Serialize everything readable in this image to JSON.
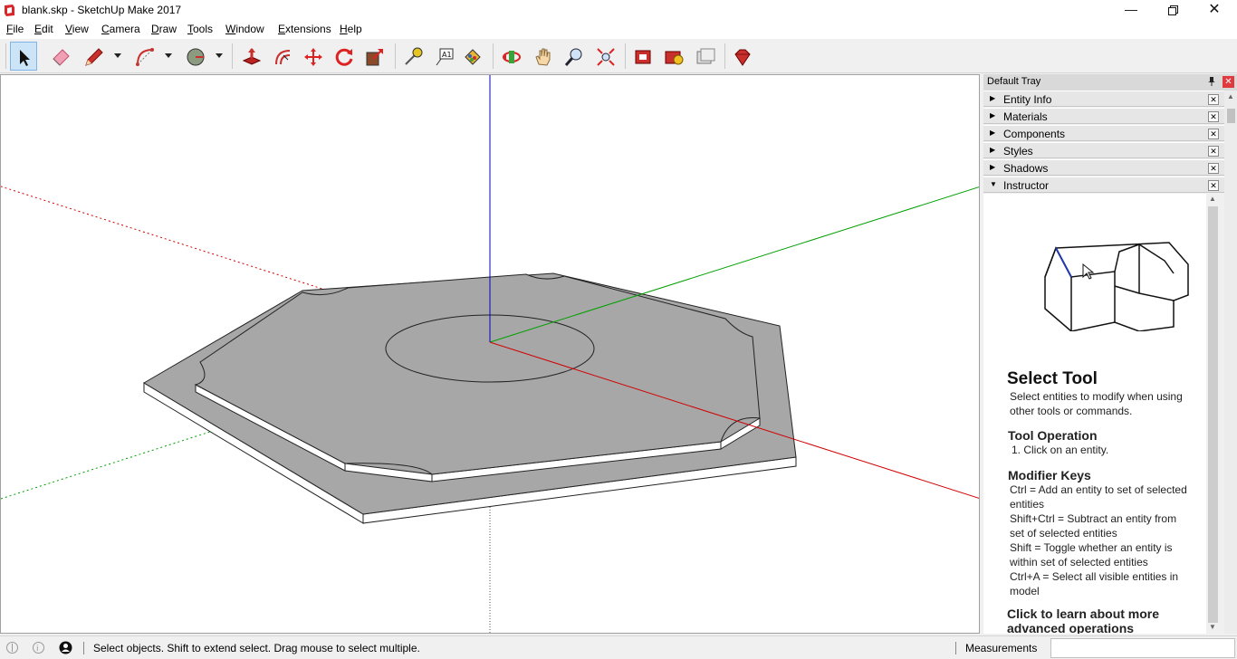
{
  "window": {
    "title": "blank.skp - SketchUp Make 2017"
  },
  "menu": [
    "File",
    "Edit",
    "View",
    "Camera",
    "Draw",
    "Tools",
    "Window",
    "Extensions",
    "Help"
  ],
  "toolbar": {
    "tools": [
      "select",
      "eraser",
      "line",
      "arc",
      "shapes",
      "push-pull",
      "offset",
      "move",
      "rotate",
      "scale",
      "tape-measure",
      "text",
      "paint-bucket",
      "orbit",
      "pan",
      "zoom",
      "zoom-extents",
      "3d-warehouse",
      "extension-warehouse",
      "layout",
      "extension-manager"
    ],
    "active_tool": "select"
  },
  "tray": {
    "title": "Default Tray",
    "panels": [
      {
        "label": "Entity Info",
        "expanded": false
      },
      {
        "label": "Materials",
        "expanded": false
      },
      {
        "label": "Components",
        "expanded": false
      },
      {
        "label": "Styles",
        "expanded": false
      },
      {
        "label": "Shadows",
        "expanded": false
      },
      {
        "label": "Instructor",
        "expanded": true
      }
    ]
  },
  "instructor": {
    "title": "Select Tool",
    "description": "Select entities to modify when using other tools or commands.",
    "operation_heading": "Tool Operation",
    "operation_text": "1. Click on an entity.",
    "modifier_heading": "Modifier Keys",
    "modifiers": [
      "Ctrl = Add an entity to set of selected entities",
      "Shift+Ctrl = Subtract an entity from set of selected entities",
      "Shift = Toggle whether an entity is within set of selected entities",
      "Ctrl+A = Select all visible entities in model"
    ],
    "link": "Click to learn about more advanced operations"
  },
  "status": {
    "message": "Select objects. Shift to extend select. Drag mouse to select multiple.",
    "measurements_label": "Measurements",
    "measurements_value": ""
  },
  "colors": {
    "red_axis": "#d00000",
    "green_axis": "#00a000",
    "blue_axis": "#0000c0",
    "model_face": "#a7a7a7",
    "active_tool_bg": "#cce4f7"
  }
}
